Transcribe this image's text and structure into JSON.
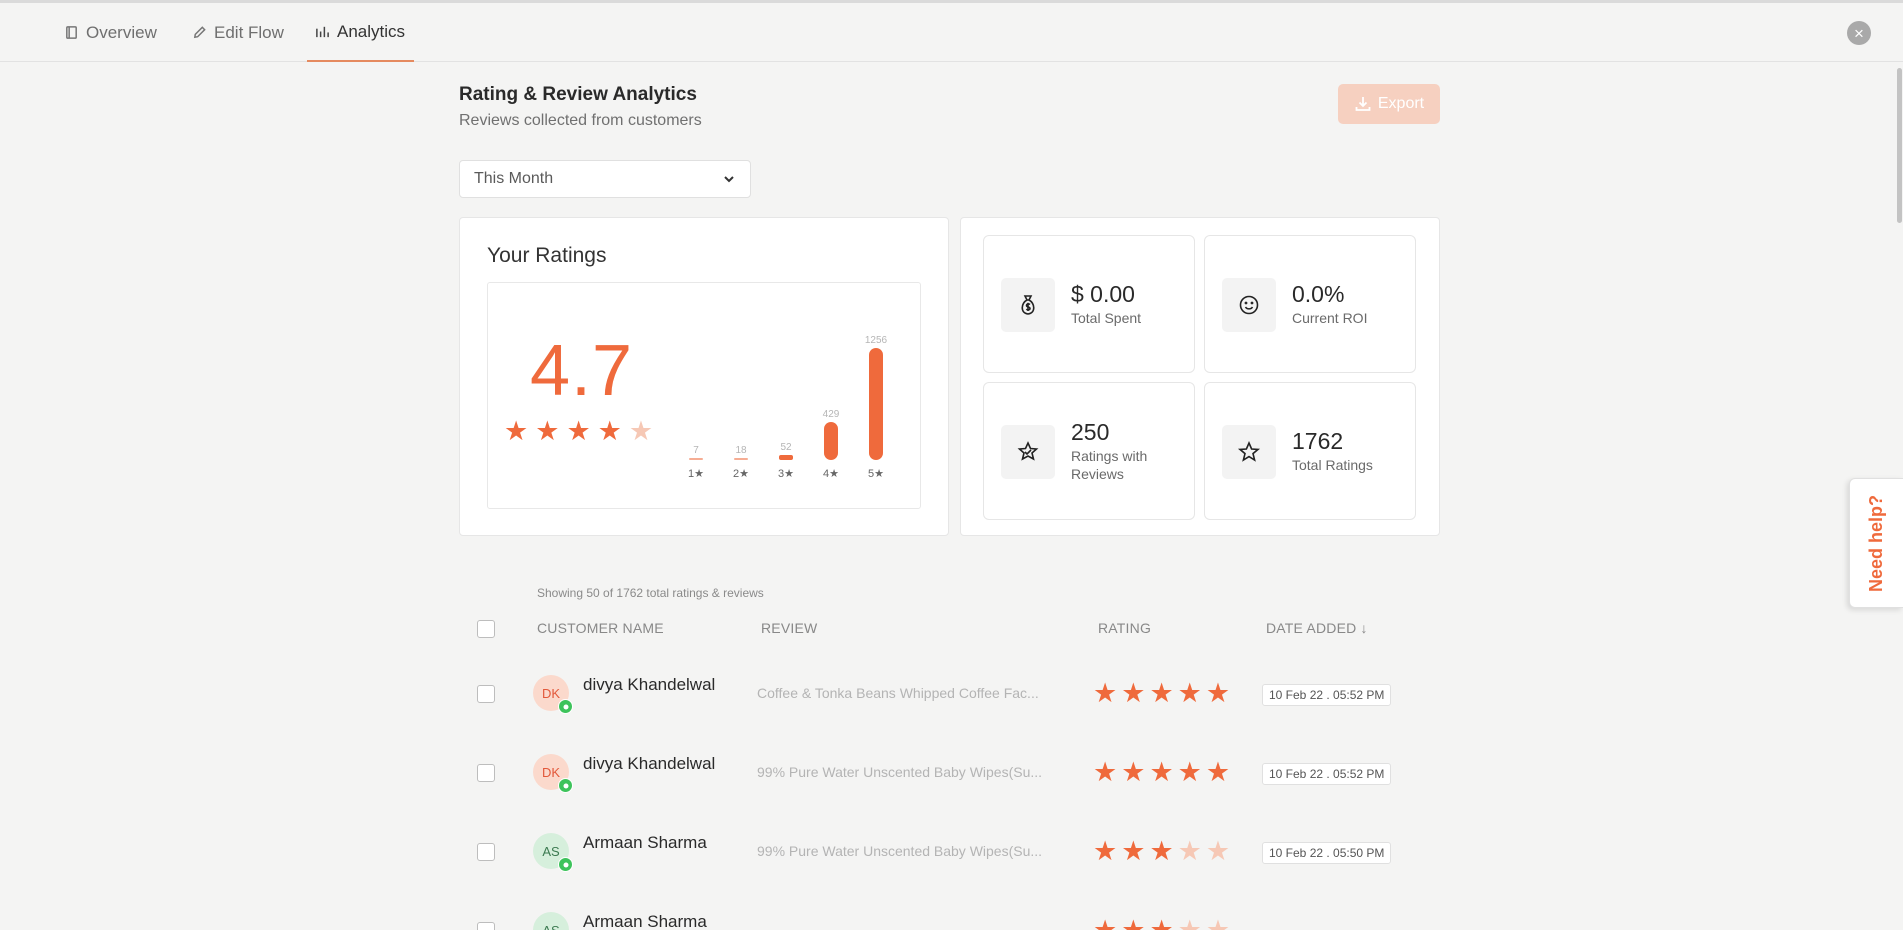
{
  "tabs": [
    {
      "label": "Overview",
      "icon": "book-icon"
    },
    {
      "label": "Edit Flow",
      "icon": "pencil-icon"
    },
    {
      "label": "Analytics",
      "icon": "bar-chart-icon",
      "active": true
    }
  ],
  "header": {
    "title": "Rating & Review Analytics",
    "subtitle": "Reviews collected from customers",
    "export_label": "Export"
  },
  "filter": {
    "selected": "This Month"
  },
  "ratings": {
    "title": "Your Ratings",
    "average": "4.7",
    "average_stars_filled": 4,
    "distribution": [
      {
        "label": "1★",
        "count": 7
      },
      {
        "label": "2★",
        "count": 18
      },
      {
        "label": "3★",
        "count": 52
      },
      {
        "label": "4★",
        "count": 429
      },
      {
        "label": "5★",
        "count": 1256
      }
    ]
  },
  "stats": [
    {
      "value": "$ 0.00",
      "label": "Total Spent",
      "icon": "money-bag-icon"
    },
    {
      "value": "0.0%",
      "label": "Current ROI",
      "icon": "smiley-icon"
    },
    {
      "value": "250",
      "label": "Ratings with Reviews",
      "icon": "star-badge-icon"
    },
    {
      "value": "1762",
      "label": "Total Ratings",
      "icon": "star-outline-icon"
    }
  ],
  "table": {
    "showing": "Showing 50 of 1762 total ratings & reviews",
    "columns": [
      "CUSTOMER NAME",
      "REVIEW",
      "RATING",
      "DATE ADDED ↓"
    ],
    "rows": [
      {
        "initials": "DK",
        "name": "divya Khandelwal",
        "review": "Coffee & Tonka Beans Whipped Coffee Fac...",
        "rating": 5,
        "date": "10 Feb 22 . 05:52 PM"
      },
      {
        "initials": "DK",
        "name": "divya Khandelwal",
        "review": "99% Pure Water Unscented Baby Wipes(Su...",
        "rating": 5,
        "date": "10 Feb 22 . 05:52 PM"
      },
      {
        "initials": "AS",
        "name": "Armaan Sharma",
        "review": "99% Pure Water Unscented Baby Wipes(Su...",
        "rating": 3,
        "date": "10 Feb 22 . 05:50 PM"
      },
      {
        "initials": "AS",
        "name": "Armaan Sharma",
        "review": "",
        "rating": 3,
        "date": ""
      }
    ]
  },
  "help": {
    "label": "Need help?"
  },
  "colors": {
    "accent": "#ef6a3c",
    "accent_light": "#f6c8b5",
    "whatsapp": "#3dc35b"
  }
}
